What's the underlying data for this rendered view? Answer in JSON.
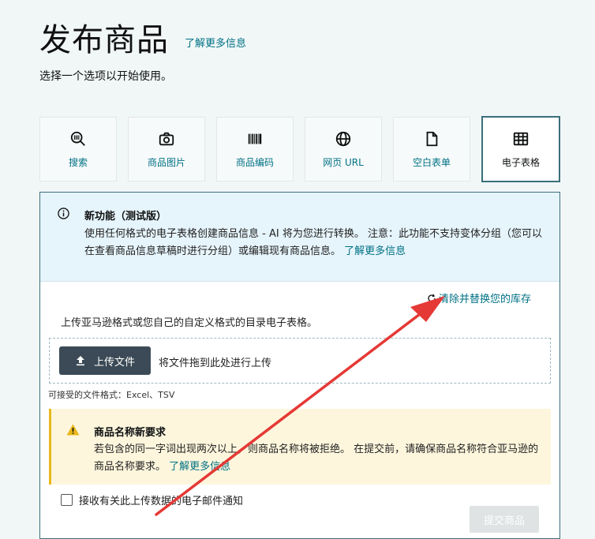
{
  "header": {
    "title": "发布商品",
    "learn_more": "了解更多信息",
    "subtitle": "选择一个选项以开始使用。"
  },
  "options": [
    {
      "label": "搜索",
      "icon": "search-barcode-icon",
      "selected": false
    },
    {
      "label": "商品图片",
      "icon": "camera-icon",
      "selected": false
    },
    {
      "label": "商品编码",
      "icon": "barcode-icon",
      "selected": false
    },
    {
      "label": "网页 URL",
      "icon": "globe-icon",
      "selected": false
    },
    {
      "label": "空白表单",
      "icon": "document-icon",
      "selected": false
    },
    {
      "label": "电子表格",
      "icon": "spreadsheet-icon",
      "selected": true
    }
  ],
  "info": {
    "title": "新功能（测试版）",
    "text": "使用任何格式的电子表格创建商品信息 - AI 将为您进行转换。 注意：此功能不支持变体分组（您可以在查看商品信息草稿时进行分组）或编辑现有商品信息。",
    "link": "了解更多信息"
  },
  "replace_link": "清除并替换您的库存",
  "upload": {
    "description": "上传亚马逊格式或您自己的自定义格式的目录电子表格。",
    "button_label": "上传文件",
    "drop_text": "将文件拖到此处进行上传",
    "formats": "可接受的文件格式：Excel、TSV"
  },
  "warning": {
    "title": "商品名称新要求",
    "text": "若包含的同一字词出现两次以上，则商品名称将被拒绝。 在提交前，请确保商品名称符合亚马逊的商品名称要求。",
    "link": "了解更多信息"
  },
  "email_notify_label": "接收有关此上传数据的电子邮件通知",
  "submit_label": "提交商品",
  "colors": {
    "link": "#007185",
    "info_bg": "#e6f4fb",
    "warning_bg": "#fdf6dd",
    "warning_accent": "#e8b71a",
    "annotation_arrow": "#e53935"
  }
}
